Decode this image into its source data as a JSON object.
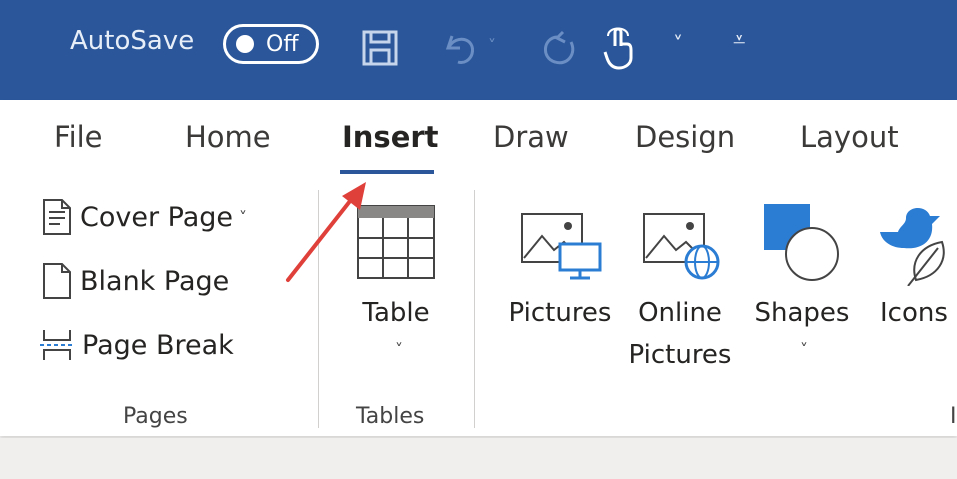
{
  "titlebar": {
    "autosave_label": "AutoSave",
    "autosave_state": "Off",
    "icons": [
      "save-icon",
      "undo-icon",
      "undo-dropdown-icon",
      "redo-icon",
      "touch-mode-icon",
      "dropdown-icon",
      "customize-qat-icon"
    ],
    "accent": "#2b579a"
  },
  "tabs": [
    {
      "label": "File"
    },
    {
      "label": "Home"
    },
    {
      "label": "Insert",
      "active": true
    },
    {
      "label": "Draw"
    },
    {
      "label": "Design"
    },
    {
      "label": "Layout"
    }
  ],
  "pages_group": {
    "cover_page": "Cover Page",
    "blank_page": "Blank Page",
    "page_break": "Page Break",
    "label": "Pages"
  },
  "tables_group": {
    "table": "Table",
    "label": "Tables"
  },
  "illustrations": {
    "pictures": "Pictures",
    "online_pictures_line1": "Online",
    "online_pictures_line2": "Pictures",
    "shapes": "Shapes",
    "icons": "Icons",
    "label_partial": "I"
  },
  "annotation": {
    "arrow_color": "#e0403a"
  }
}
